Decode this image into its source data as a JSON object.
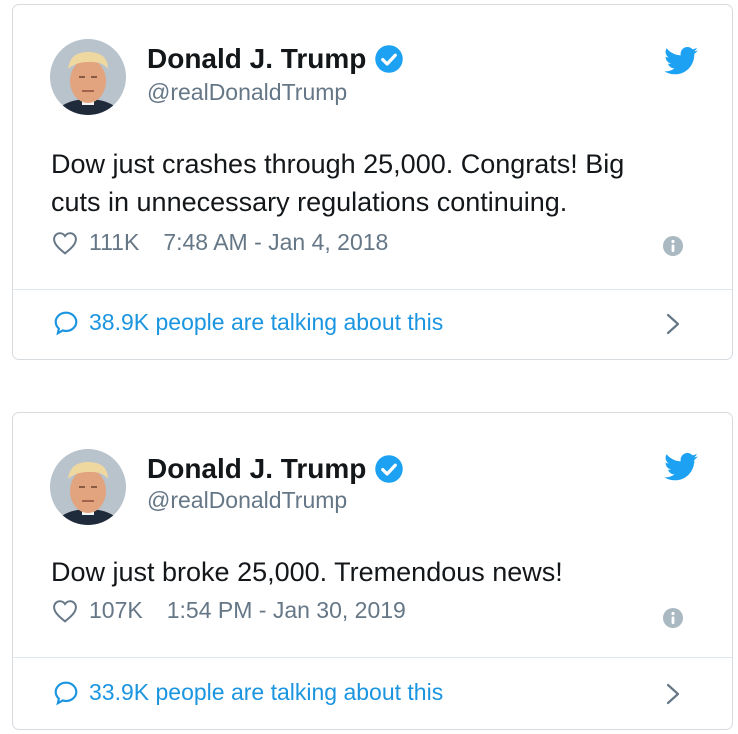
{
  "tweets": [
    {
      "name": "Donald J. Trump",
      "handle": "@realDonaldTrump",
      "text_line1": "Dow just crashes through 25,000. Congrats! Big",
      "text_line2": "cuts in unnecessary regulations continuing.",
      "likes": "111K",
      "timestamp": "7:48 AM - Jan 4, 2018",
      "conversation": "38.9K people are talking about this",
      "icons": [
        "avatar",
        "verified-badge-icon",
        "twitter-bird-icon",
        "heart-icon",
        "info-icon",
        "speech-bubble-icon",
        "chevron-right-icon"
      ]
    },
    {
      "name": "Donald J. Trump",
      "handle": "@realDonaldTrump",
      "text_line1": "Dow just broke 25,000. Tremendous news!",
      "text_line2": "",
      "likes": "107K",
      "timestamp": "1:54 PM - Jan 30, 2019",
      "conversation": "33.9K people are talking about this",
      "icons": [
        "avatar",
        "verified-badge-icon",
        "twitter-bird-icon",
        "heart-icon",
        "info-icon",
        "speech-bubble-icon",
        "chevron-right-icon"
      ]
    }
  ],
  "colors": {
    "twitter_blue": "#1da1f2",
    "link_blue": "#1b95e0",
    "text": "#14171a",
    "secondary_text": "#657786",
    "border": "#d6dbe0"
  }
}
